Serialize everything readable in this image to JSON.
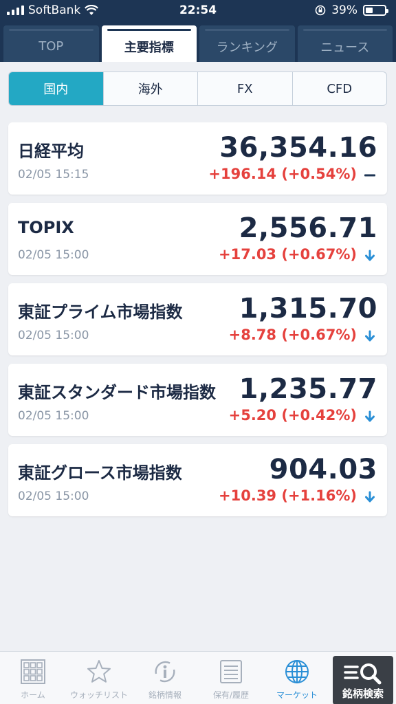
{
  "status_bar": {
    "carrier": "SoftBank",
    "time": "22:54",
    "battery": "39%"
  },
  "top_tabs": [
    {
      "label": "TOP",
      "active": false
    },
    {
      "label": "主要指標",
      "active": true
    },
    {
      "label": "ランキング",
      "active": false
    },
    {
      "label": "ニュース",
      "active": false
    }
  ],
  "segments": [
    {
      "label": "国内",
      "active": true
    },
    {
      "label": "海外",
      "active": false
    },
    {
      "label": "FX",
      "active": false
    },
    {
      "label": "CFD",
      "active": false
    }
  ],
  "indices": [
    {
      "name": "日経平均",
      "date": "02/05 15:15",
      "value": "36,354.16",
      "change": "+196.14 (+0.54%)",
      "trend": "flat-icon"
    },
    {
      "name": "TOPIX",
      "date": "02/05 15:00",
      "value": "2,556.71",
      "change": "+17.03 (+0.67%)",
      "trend": "down-arrow-icon"
    },
    {
      "name": "東証プライム市場指数",
      "date": "02/05 15:00",
      "value": "1,315.70",
      "change": "+8.78 (+0.67%)",
      "trend": "down-arrow-icon"
    },
    {
      "name": "東証スタンダード市場指数",
      "date": "02/05 15:00",
      "value": "1,235.77",
      "change": "+5.20 (+0.42%)",
      "trend": "down-arrow-icon"
    },
    {
      "name": "東証グロース市場指数",
      "date": "02/05 15:00",
      "value": "904.03",
      "change": "+10.39 (+1.16%)",
      "trend": "down-arrow-icon"
    }
  ],
  "bottom_nav": [
    {
      "label": "ホーム",
      "icon": "home-grid-icon"
    },
    {
      "label": "ウォッチリスト",
      "icon": "star-icon"
    },
    {
      "label": "銘柄情報",
      "icon": "info-icon"
    },
    {
      "label": "保有/履歴",
      "icon": "list-icon"
    },
    {
      "label": "マーケット",
      "icon": "globe-icon",
      "active": true
    },
    {
      "label": "銘柄検索",
      "icon": "search-icon"
    }
  ],
  "colors": {
    "header": "#1d3554",
    "accent": "#23a8c4",
    "positive": "#e5413d",
    "arrow": "#2a8fd6",
    "active_nav": "#2a8fd6"
  }
}
